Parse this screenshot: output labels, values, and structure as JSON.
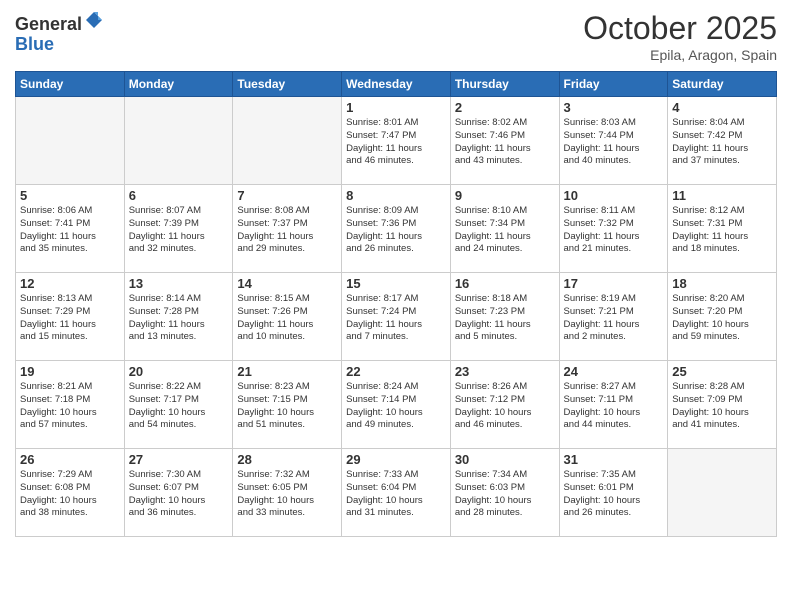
{
  "header": {
    "logo_general": "General",
    "logo_blue": "Blue",
    "month": "October 2025",
    "location": "Epila, Aragon, Spain"
  },
  "days_of_week": [
    "Sunday",
    "Monday",
    "Tuesday",
    "Wednesday",
    "Thursday",
    "Friday",
    "Saturday"
  ],
  "weeks": [
    [
      {
        "day": "",
        "info": "",
        "empty": true
      },
      {
        "day": "",
        "info": "",
        "empty": true
      },
      {
        "day": "",
        "info": "",
        "empty": true
      },
      {
        "day": "1",
        "info": "Sunrise: 8:01 AM\nSunset: 7:47 PM\nDaylight: 11 hours\nand 46 minutes."
      },
      {
        "day": "2",
        "info": "Sunrise: 8:02 AM\nSunset: 7:46 PM\nDaylight: 11 hours\nand 43 minutes."
      },
      {
        "day": "3",
        "info": "Sunrise: 8:03 AM\nSunset: 7:44 PM\nDaylight: 11 hours\nand 40 minutes."
      },
      {
        "day": "4",
        "info": "Sunrise: 8:04 AM\nSunset: 7:42 PM\nDaylight: 11 hours\nand 37 minutes."
      }
    ],
    [
      {
        "day": "5",
        "info": "Sunrise: 8:06 AM\nSunset: 7:41 PM\nDaylight: 11 hours\nand 35 minutes."
      },
      {
        "day": "6",
        "info": "Sunrise: 8:07 AM\nSunset: 7:39 PM\nDaylight: 11 hours\nand 32 minutes."
      },
      {
        "day": "7",
        "info": "Sunrise: 8:08 AM\nSunset: 7:37 PM\nDaylight: 11 hours\nand 29 minutes."
      },
      {
        "day": "8",
        "info": "Sunrise: 8:09 AM\nSunset: 7:36 PM\nDaylight: 11 hours\nand 26 minutes."
      },
      {
        "day": "9",
        "info": "Sunrise: 8:10 AM\nSunset: 7:34 PM\nDaylight: 11 hours\nand 24 minutes."
      },
      {
        "day": "10",
        "info": "Sunrise: 8:11 AM\nSunset: 7:32 PM\nDaylight: 11 hours\nand 21 minutes."
      },
      {
        "day": "11",
        "info": "Sunrise: 8:12 AM\nSunset: 7:31 PM\nDaylight: 11 hours\nand 18 minutes."
      }
    ],
    [
      {
        "day": "12",
        "info": "Sunrise: 8:13 AM\nSunset: 7:29 PM\nDaylight: 11 hours\nand 15 minutes."
      },
      {
        "day": "13",
        "info": "Sunrise: 8:14 AM\nSunset: 7:28 PM\nDaylight: 11 hours\nand 13 minutes."
      },
      {
        "day": "14",
        "info": "Sunrise: 8:15 AM\nSunset: 7:26 PM\nDaylight: 11 hours\nand 10 minutes."
      },
      {
        "day": "15",
        "info": "Sunrise: 8:17 AM\nSunset: 7:24 PM\nDaylight: 11 hours\nand 7 minutes."
      },
      {
        "day": "16",
        "info": "Sunrise: 8:18 AM\nSunset: 7:23 PM\nDaylight: 11 hours\nand 5 minutes."
      },
      {
        "day": "17",
        "info": "Sunrise: 8:19 AM\nSunset: 7:21 PM\nDaylight: 11 hours\nand 2 minutes."
      },
      {
        "day": "18",
        "info": "Sunrise: 8:20 AM\nSunset: 7:20 PM\nDaylight: 10 hours\nand 59 minutes."
      }
    ],
    [
      {
        "day": "19",
        "info": "Sunrise: 8:21 AM\nSunset: 7:18 PM\nDaylight: 10 hours\nand 57 minutes."
      },
      {
        "day": "20",
        "info": "Sunrise: 8:22 AM\nSunset: 7:17 PM\nDaylight: 10 hours\nand 54 minutes."
      },
      {
        "day": "21",
        "info": "Sunrise: 8:23 AM\nSunset: 7:15 PM\nDaylight: 10 hours\nand 51 minutes."
      },
      {
        "day": "22",
        "info": "Sunrise: 8:24 AM\nSunset: 7:14 PM\nDaylight: 10 hours\nand 49 minutes."
      },
      {
        "day": "23",
        "info": "Sunrise: 8:26 AM\nSunset: 7:12 PM\nDaylight: 10 hours\nand 46 minutes."
      },
      {
        "day": "24",
        "info": "Sunrise: 8:27 AM\nSunset: 7:11 PM\nDaylight: 10 hours\nand 44 minutes."
      },
      {
        "day": "25",
        "info": "Sunrise: 8:28 AM\nSunset: 7:09 PM\nDaylight: 10 hours\nand 41 minutes."
      }
    ],
    [
      {
        "day": "26",
        "info": "Sunrise: 7:29 AM\nSunset: 6:08 PM\nDaylight: 10 hours\nand 38 minutes."
      },
      {
        "day": "27",
        "info": "Sunrise: 7:30 AM\nSunset: 6:07 PM\nDaylight: 10 hours\nand 36 minutes."
      },
      {
        "day": "28",
        "info": "Sunrise: 7:32 AM\nSunset: 6:05 PM\nDaylight: 10 hours\nand 33 minutes."
      },
      {
        "day": "29",
        "info": "Sunrise: 7:33 AM\nSunset: 6:04 PM\nDaylight: 10 hours\nand 31 minutes."
      },
      {
        "day": "30",
        "info": "Sunrise: 7:34 AM\nSunset: 6:03 PM\nDaylight: 10 hours\nand 28 minutes."
      },
      {
        "day": "31",
        "info": "Sunrise: 7:35 AM\nSunset: 6:01 PM\nDaylight: 10 hours\nand 26 minutes."
      },
      {
        "day": "",
        "info": "",
        "empty": true
      }
    ]
  ]
}
